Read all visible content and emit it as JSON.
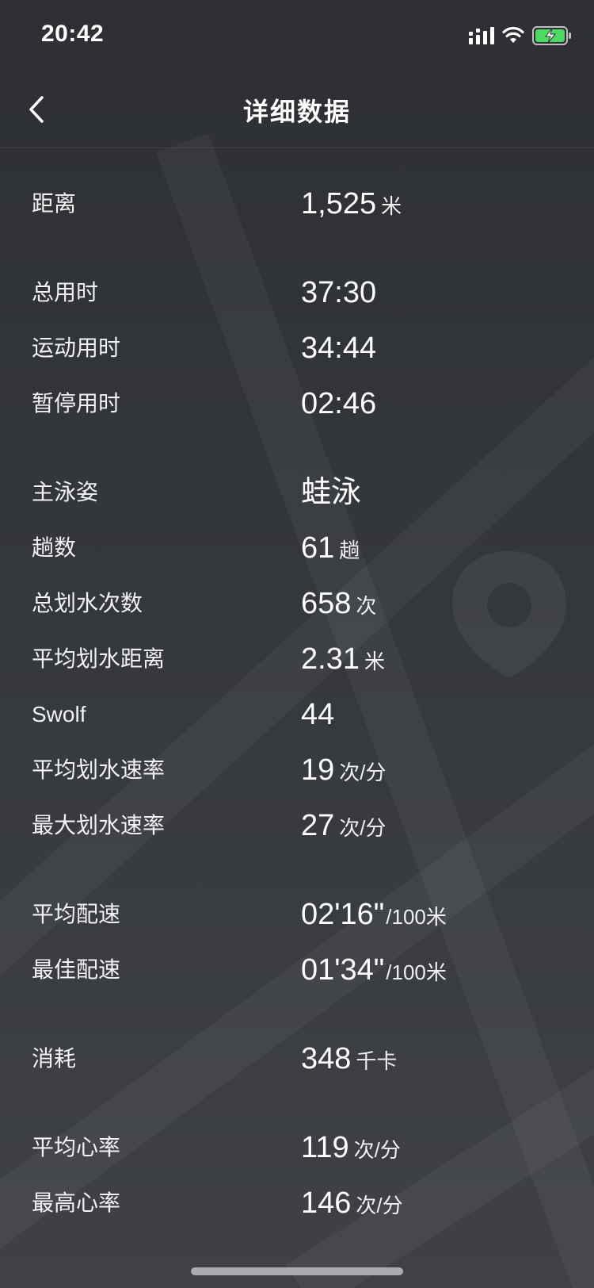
{
  "status_bar": {
    "time": "20:42"
  },
  "nav": {
    "title": "详细数据"
  },
  "groups": [
    [
      {
        "label": "距离",
        "value": "1,525",
        "unit": "米"
      }
    ],
    [
      {
        "label": "总用时",
        "value": "37:30",
        "unit": ""
      },
      {
        "label": "运动用时",
        "value": "34:44",
        "unit": ""
      },
      {
        "label": "暂停用时",
        "value": "02:46",
        "unit": ""
      }
    ],
    [
      {
        "label": "主泳姿",
        "value": "蛙泳",
        "unit": ""
      },
      {
        "label": "趟数",
        "value": "61",
        "unit": "趟"
      },
      {
        "label": "总划水次数",
        "value": "658",
        "unit": "次"
      },
      {
        "label": "平均划水距离",
        "value": "2.31",
        "unit": "米"
      },
      {
        "label": "Swolf",
        "value": "44",
        "unit": ""
      },
      {
        "label": "平均划水速率",
        "value": "19",
        "unit": "次/分"
      },
      {
        "label": "最大划水速率",
        "value": "27",
        "unit": "次/分"
      }
    ],
    [
      {
        "label": "平均配速",
        "value": "02'16\"",
        "unit": "/100米"
      },
      {
        "label": "最佳配速",
        "value": "01'34\"",
        "unit": "/100米"
      }
    ],
    [
      {
        "label": "消耗",
        "value": "348",
        "unit": "千卡"
      }
    ],
    [
      {
        "label": "平均心率",
        "value": "119",
        "unit": "次/分"
      },
      {
        "label": "最高心率",
        "value": "146",
        "unit": "次/分"
      }
    ]
  ],
  "icons": {
    "back": "chevron-left-icon",
    "signal": "cellular-signal-icon",
    "wifi": "wifi-icon",
    "battery": "battery-charging-icon",
    "map_pin": "map-pin-icon"
  },
  "colors": {
    "background": "#34373c",
    "text": "#ffffff",
    "battery": "#4cd964"
  }
}
